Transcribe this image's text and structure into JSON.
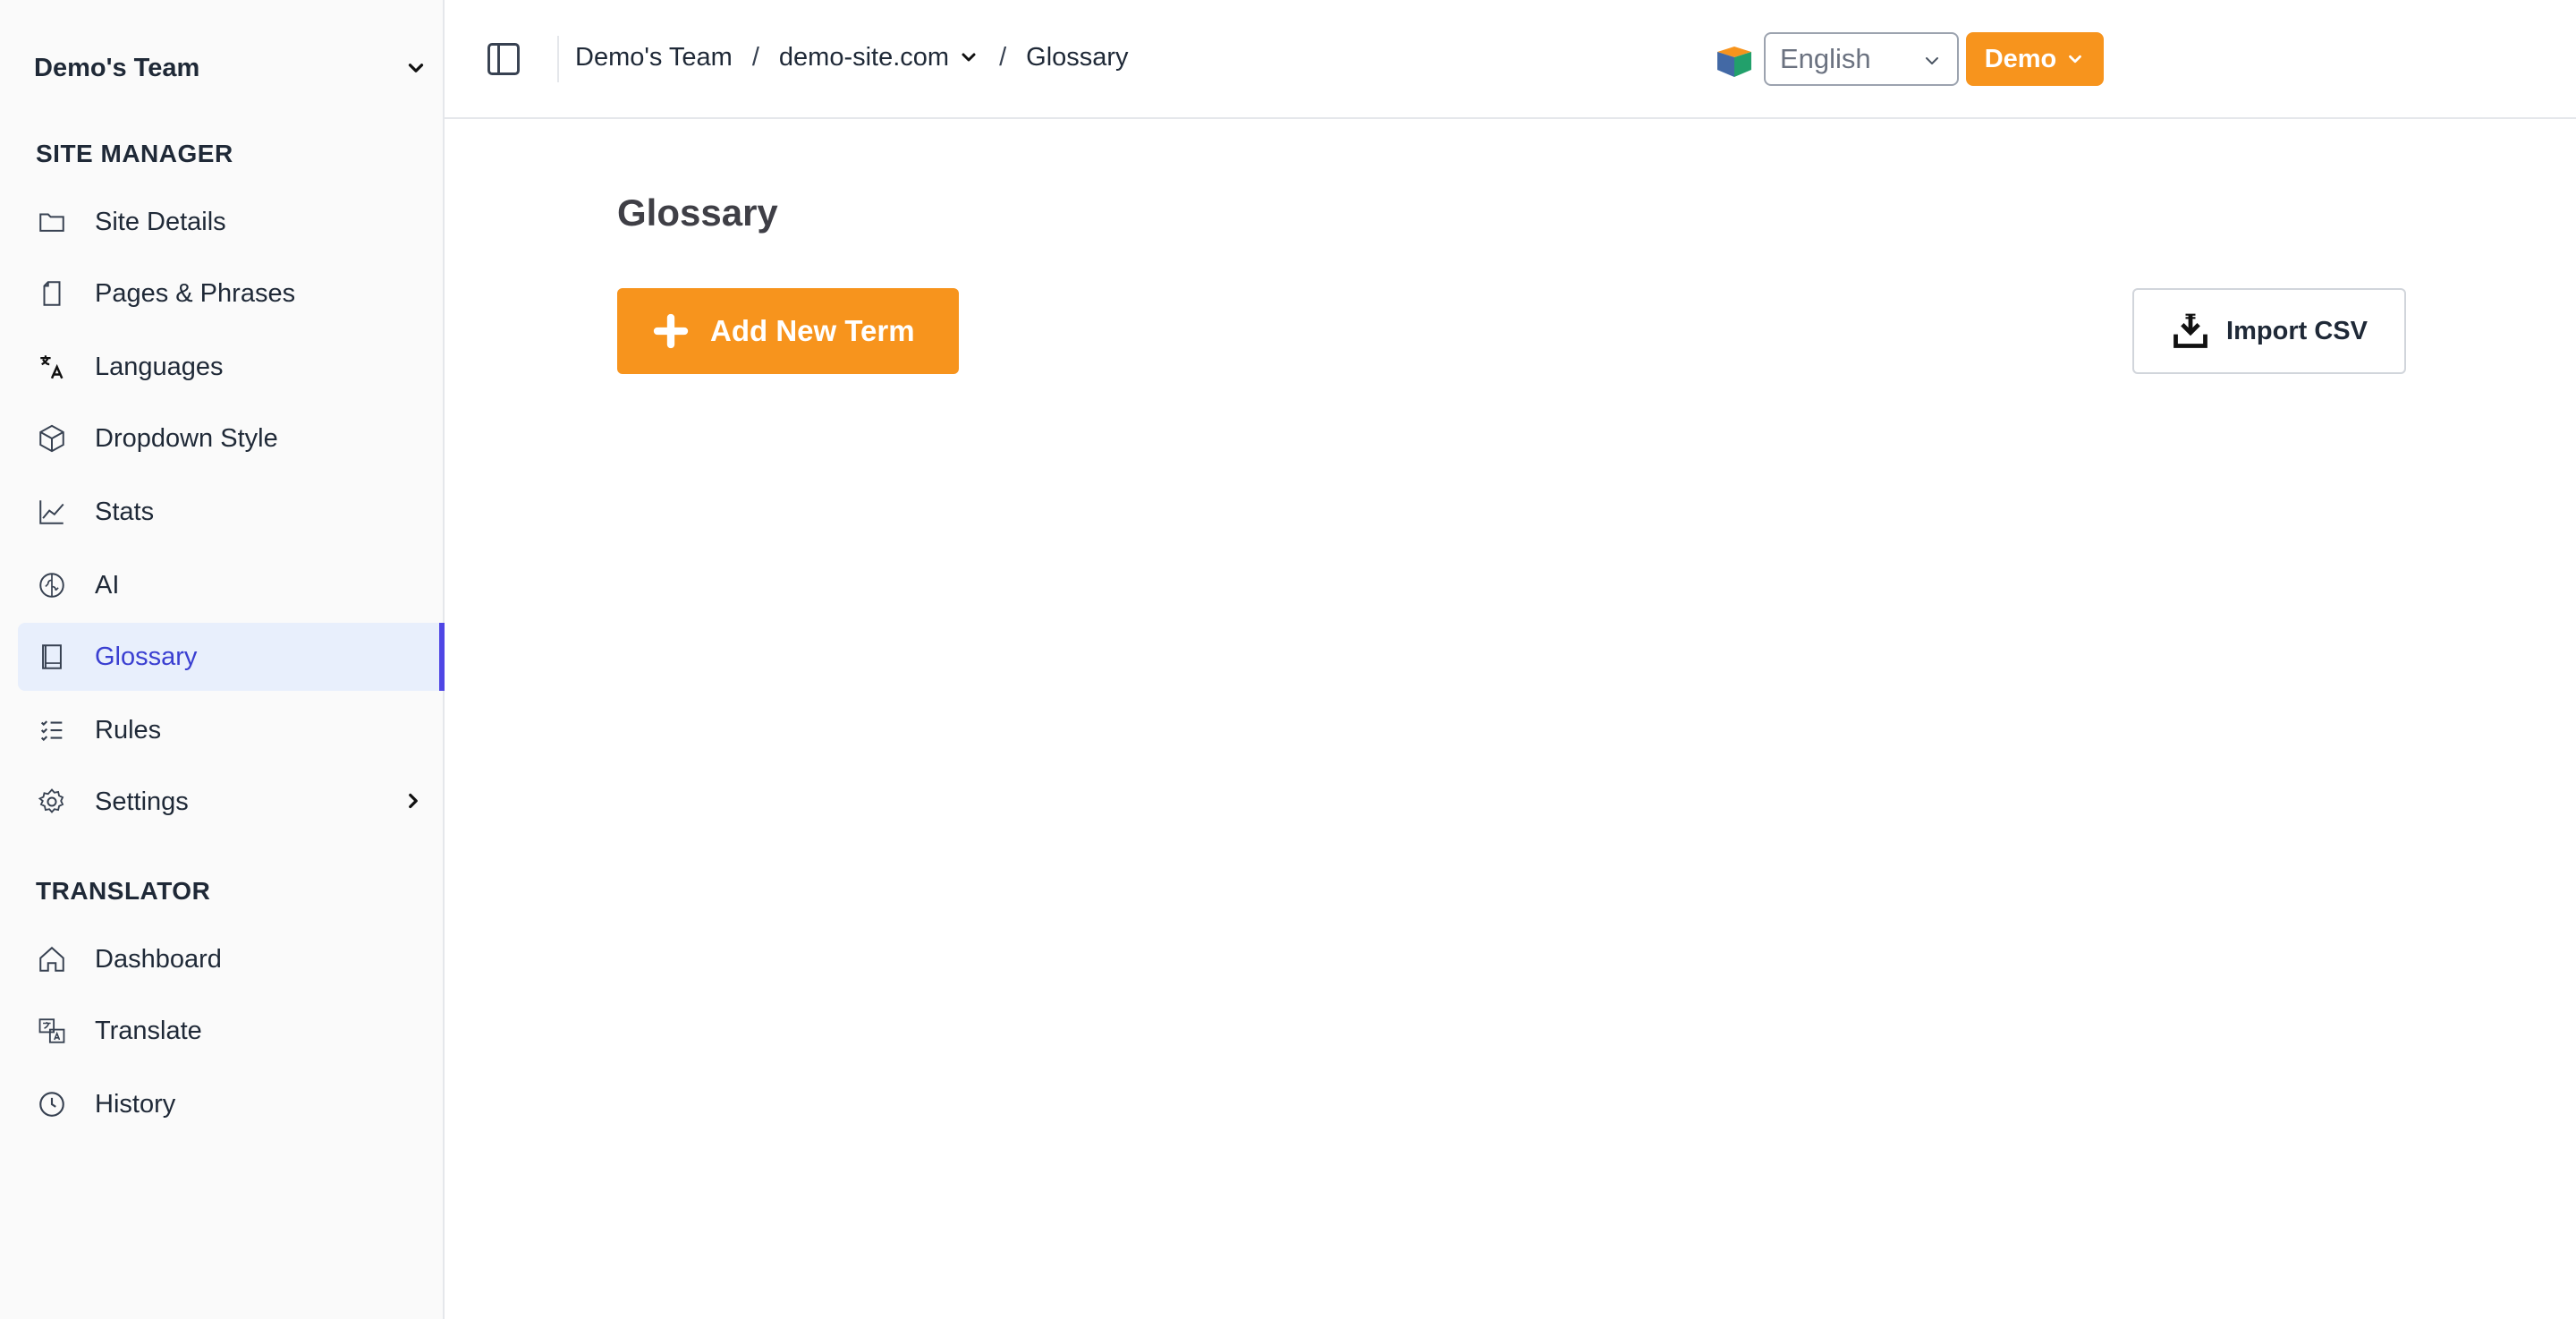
{
  "sidebar": {
    "team_name": "Demo's Team",
    "site_manager_title": "SITE MANAGER",
    "site_manager_items": [
      {
        "label": "Site Details",
        "icon": "folder-icon"
      },
      {
        "label": "Pages & Phrases",
        "icon": "page-icon"
      },
      {
        "label": "Languages",
        "icon": "translate-icon"
      },
      {
        "label": "Dropdown Style",
        "icon": "cube-icon"
      },
      {
        "label": "Stats",
        "icon": "chart-icon"
      },
      {
        "label": "AI",
        "icon": "brain-icon"
      },
      {
        "label": "Glossary",
        "icon": "book-icon",
        "active": true
      },
      {
        "label": "Rules",
        "icon": "list-icon"
      },
      {
        "label": "Settings",
        "icon": "gear-icon"
      }
    ],
    "translator_title": "TRANSLATOR",
    "translator_items": [
      {
        "label": "Dashboard",
        "icon": "home-icon"
      },
      {
        "label": "Translate",
        "icon": "language-card-icon"
      },
      {
        "label": "History",
        "icon": "clock-icon"
      }
    ]
  },
  "header": {
    "breadcrumb": {
      "team": "Demo's Team",
      "site": "demo-site.com",
      "page": "Glossary",
      "separator": "/"
    },
    "language_select": {
      "value": "English"
    },
    "user_button": "Demo"
  },
  "main": {
    "title": "Glossary",
    "add_button": "Add New Term",
    "import_button": "Import CSV"
  },
  "colors": {
    "accent_orange": "#f7941d",
    "active_blue": "#3a3fd1",
    "active_bg": "#e8effc",
    "active_bar": "#4f46e5"
  }
}
